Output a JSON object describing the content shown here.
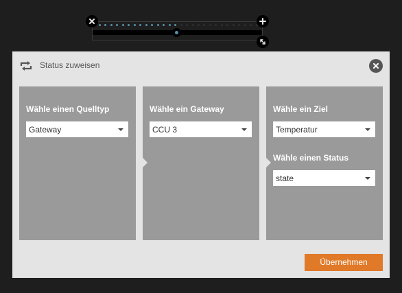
{
  "widget": {
    "close_icon": "close-icon",
    "add_icon": "plus-icon",
    "resize_icon": "resize-icon",
    "slider_level": 0.5,
    "accent_color": "#5a90a8"
  },
  "dialog": {
    "title": "Status zuweisen",
    "title_icon": "repeat-icon",
    "close_icon": "close-icon",
    "steps": [
      {
        "label": "Wähle einen Quelltyp",
        "select_value": "Gateway"
      },
      {
        "label": "Wähle ein Gateway",
        "select_value": "CCU 3"
      },
      {
        "label": "Wähle ein Ziel",
        "select_value": "Temperatur",
        "label_2": "Wähle einen Status",
        "select_value_2": "state"
      }
    ],
    "submit_label": "Übernehmen",
    "submit_color": "#e07a29",
    "panel_color": "#9a9a9a"
  }
}
